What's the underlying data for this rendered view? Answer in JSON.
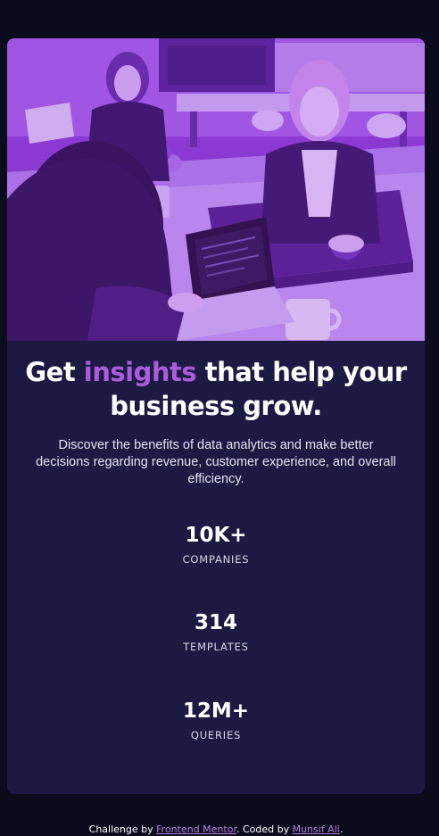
{
  "card": {
    "headline": {
      "part1": "Get ",
      "accent": "insights",
      "part2": " that help your business grow."
    },
    "description": "Discover the benefits of data analytics and make better decisions regarding revenue, customer experience, and overall efficiency.",
    "stats": [
      {
        "value": "10K+",
        "label": "COMPANIES"
      },
      {
        "value": "314",
        "label": "TEMPLATES"
      },
      {
        "value": "12M+",
        "label": "QUERIES"
      }
    ]
  },
  "footer": {
    "prefix": "Challenge by ",
    "challenge_link": "Frontend Mentor",
    "middle": ". Coded by ",
    "author_link": "Munsif Ali",
    "suffix": "."
  },
  "colors": {
    "page_background": "#0a0c1c",
    "card_background": "#1c1a43",
    "accent": "#aa5cdb",
    "image_overlay": "#8c2fd6"
  }
}
